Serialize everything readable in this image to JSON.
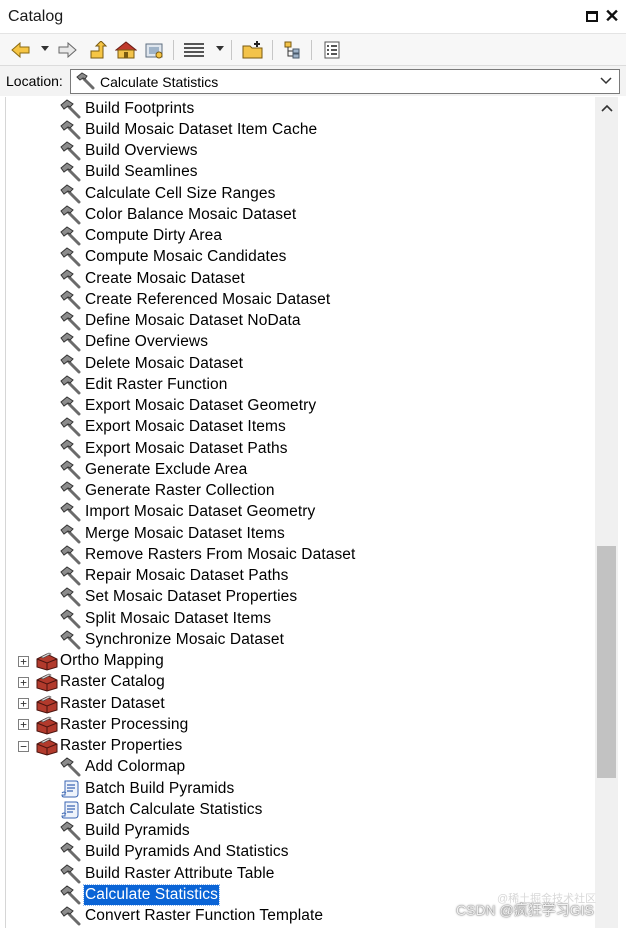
{
  "window": {
    "title": "Catalog"
  },
  "toolbar": {
    "buttons": [
      "back-icon",
      "forward-icon",
      "up-one-level-icon",
      "home-folder-icon",
      "connect-folder-icon",
      "view-details-icon",
      "add-item-icon",
      "toggle-contents-icon",
      "options-icon"
    ]
  },
  "location": {
    "label": "Location:",
    "value": "Calculate Statistics",
    "icon": "hammer-icon"
  },
  "tree": {
    "tools_top": [
      "Build Footprints",
      "Build Mosaic Dataset Item Cache",
      "Build Overviews",
      "Build Seamlines",
      "Calculate Cell Size Ranges",
      "Color Balance Mosaic Dataset",
      "Compute Dirty Area",
      "Compute Mosaic Candidates",
      "Create Mosaic Dataset",
      "Create Referenced Mosaic Dataset",
      "Define Mosaic Dataset NoData",
      "Define Overviews",
      "Delete Mosaic Dataset",
      "Edit Raster Function",
      "Export Mosaic Dataset Geometry",
      "Export Mosaic Dataset Items",
      "Export Mosaic Dataset Paths",
      "Generate Exclude Area",
      "Generate Raster Collection",
      "Import Mosaic Dataset Geometry",
      "Merge Mosaic Dataset Items",
      "Remove Rasters From Mosaic Dataset",
      "Repair Mosaic Dataset Paths",
      "Set Mosaic Dataset Properties",
      "Split Mosaic Dataset Items",
      "Synchronize Mosaic Dataset"
    ],
    "toolsets": [
      {
        "label": "Ortho Mapping",
        "expander": "+"
      },
      {
        "label": "Raster Catalog",
        "expander": "+"
      },
      {
        "label": "Raster Dataset",
        "expander": "+"
      },
      {
        "label": "Raster Processing",
        "expander": "+"
      },
      {
        "label": "Raster Properties",
        "expander": "−"
      }
    ],
    "tools_raster_properties": [
      {
        "label": "Add Colormap",
        "icon": "hammer-icon"
      },
      {
        "label": "Batch Build Pyramids",
        "icon": "script-icon"
      },
      {
        "label": "Batch Calculate Statistics",
        "icon": "script-icon"
      },
      {
        "label": "Build Pyramids",
        "icon": "hammer-icon"
      },
      {
        "label": "Build Pyramids And Statistics",
        "icon": "hammer-icon"
      },
      {
        "label": "Build Raster Attribute Table",
        "icon": "hammer-icon"
      },
      {
        "label": "Calculate Statistics",
        "icon": "hammer-icon",
        "selected": true
      },
      {
        "label": "Convert Raster Function Template",
        "icon": "hammer-icon"
      }
    ]
  },
  "watermark": {
    "text": "CSDN @疯狂学习GIS",
    "faint_text": "@稀土掘金技术社区"
  }
}
